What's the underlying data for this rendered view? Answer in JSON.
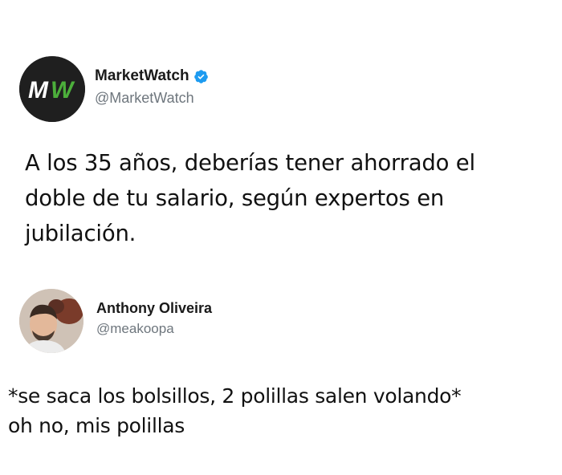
{
  "tweets": [
    {
      "author": {
        "display_name": "MarketWatch",
        "handle": "@MarketWatch",
        "verified": true,
        "avatar_text": "MW"
      },
      "text": "A los 35 años, deberías tener ahorrado el doble de tu salario, según expertos en jubilación."
    },
    {
      "author": {
        "display_name": "Anthony Oliveira",
        "handle": "@meakoopa",
        "verified": false
      },
      "text_lines": [
        "*se saca los bolsillos, 2 polillas salen volando*",
        "oh no, mis polillas"
      ]
    }
  ],
  "colors": {
    "verified_badge": "#1d9bf0",
    "brand_green": "#4caf3b",
    "handle_gray": "#6e767d"
  },
  "icons": {
    "verified": "verified-badge-icon"
  }
}
